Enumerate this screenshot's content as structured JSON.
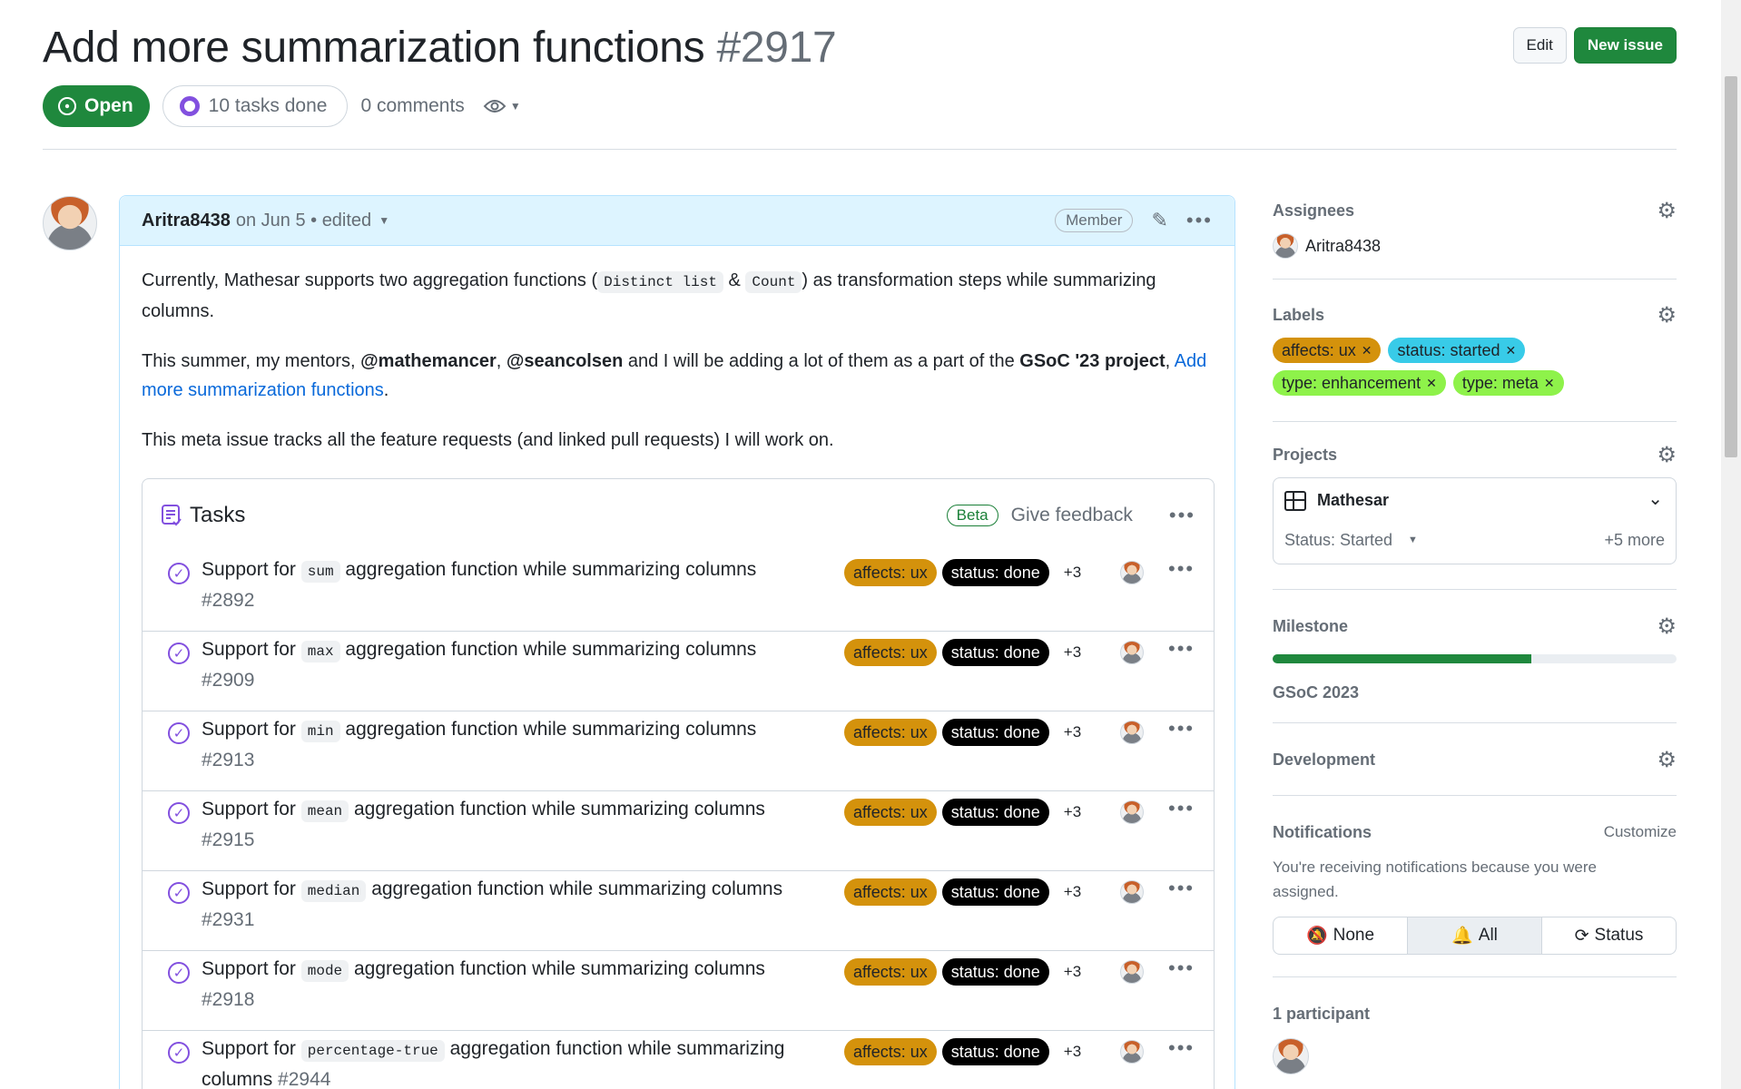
{
  "issue": {
    "title": "Add more summarization functions",
    "number": "#2917",
    "state": "Open",
    "tasks_done": "10 tasks done",
    "comments": "0 comments"
  },
  "header": {
    "edit_label": "Edit",
    "new_issue_label": "New issue"
  },
  "comment": {
    "author": "Aritra8438",
    "meta": "on Jun 5 • edited",
    "role": "Member",
    "p1_a": "Currently, Mathesar supports two aggregation functions (",
    "code1": "Distinct list",
    "amp": "&",
    "code2": "Count",
    "p1_b": ") as transformation steps while summarizing columns.",
    "p2_a": "This summer, my mentors,",
    "mention1": "@mathemancer",
    "mention2": "@seancolsen",
    "p2_b": "and I will be adding a lot of them as a part of the",
    "project_bold": "GSoC '23 project",
    "link": "Add more summarization functions",
    "p3": "This meta issue tracks all the feature requests (and linked pull requests) I will work on."
  },
  "tasklist": {
    "title": "Tasks",
    "beta": "Beta",
    "feedback": "Give feedback",
    "label_ux": "affects: ux",
    "label_done": "status: done",
    "more": "+3",
    "prefix": "Support for",
    "suffix": "aggregation function while summarizing columns",
    "items": [
      {
        "code": "sum",
        "num": "#2892"
      },
      {
        "code": "max",
        "num": "#2909"
      },
      {
        "code": "min",
        "num": "#2913"
      },
      {
        "code": "mean",
        "num": "#2915"
      },
      {
        "code": "median",
        "num": "#2931"
      },
      {
        "code": "mode",
        "num": "#2918"
      },
      {
        "code": "percentage-true",
        "num": "#2944"
      }
    ]
  },
  "sidebar": {
    "assignees_title": "Assignees",
    "assignee": "Aritra8438",
    "labels_title": "Labels",
    "labels": [
      {
        "text": "affects: ux",
        "color": "#d4920c"
      },
      {
        "text": "status: started",
        "color": "#38cbe8"
      },
      {
        "text": "type: enhancement",
        "color": "#8ef24a"
      },
      {
        "text": "type: meta",
        "color": "#8ef24a"
      }
    ],
    "projects_title": "Projects",
    "project_name": "Mathesar",
    "project_status": "Status: Started",
    "project_more": "+5 more",
    "milestone_title": "Milestone",
    "milestone_name": "GSoC 2023",
    "milestone_progress": 0.64,
    "development_title": "Development",
    "notifications_title": "Notifications",
    "customize": "Customize",
    "notif_text": "You're receiving notifications because you were assigned.",
    "notif_none": "None",
    "notif_all": "All",
    "notif_status": "Status",
    "participants": "1 participant"
  },
  "colors": {
    "green": "#1f883d",
    "purple": "#8250df",
    "blue_link": "#0969da"
  }
}
